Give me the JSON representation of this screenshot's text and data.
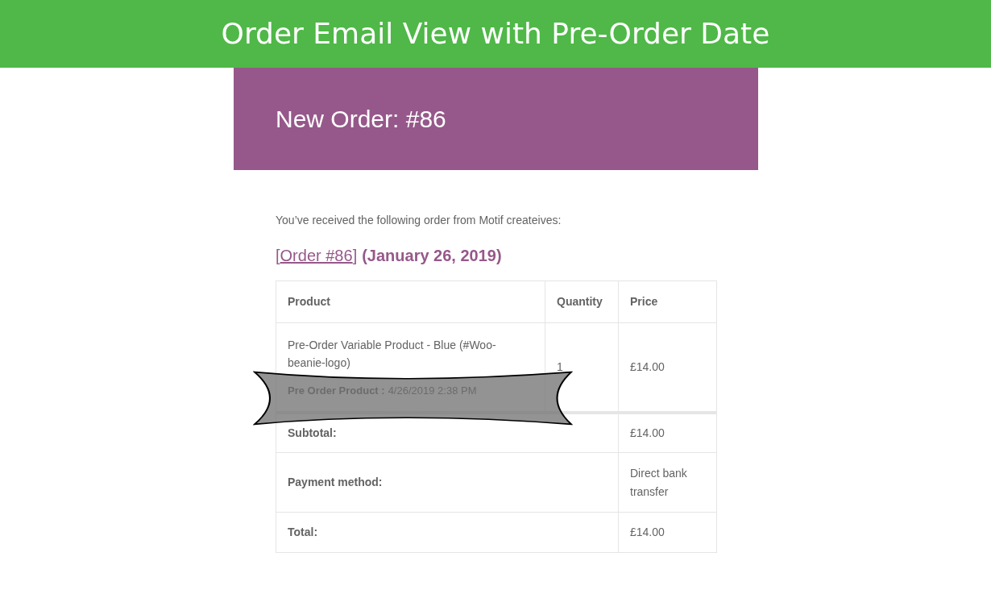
{
  "banner": {
    "title": "Order Email View with Pre-Order Date"
  },
  "email": {
    "heading": "New Order: #86",
    "intro": "You’ve received the following order from Motif createives:",
    "order_link_open": "[",
    "order_link": "Order #86",
    "order_link_close": "]",
    "order_date": "(January 26, 2019)",
    "table": {
      "columns": [
        "Product",
        "Quantity",
        "Price"
      ],
      "items": [
        {
          "name": "Pre-Order Variable Product - Blue (#Woo-beanie-logo)",
          "meta_label": "Pre Order Product :",
          "meta_value": "4/26/2019 2:38 PM",
          "quantity": "1",
          "price": "£14.00"
        }
      ],
      "totals": [
        {
          "label": "Subtotal:",
          "value": "£14.00"
        },
        {
          "label": "Payment method:",
          "value": "Direct bank transfer"
        },
        {
          "label": "Total:",
          "value": "£14.00"
        }
      ]
    }
  }
}
